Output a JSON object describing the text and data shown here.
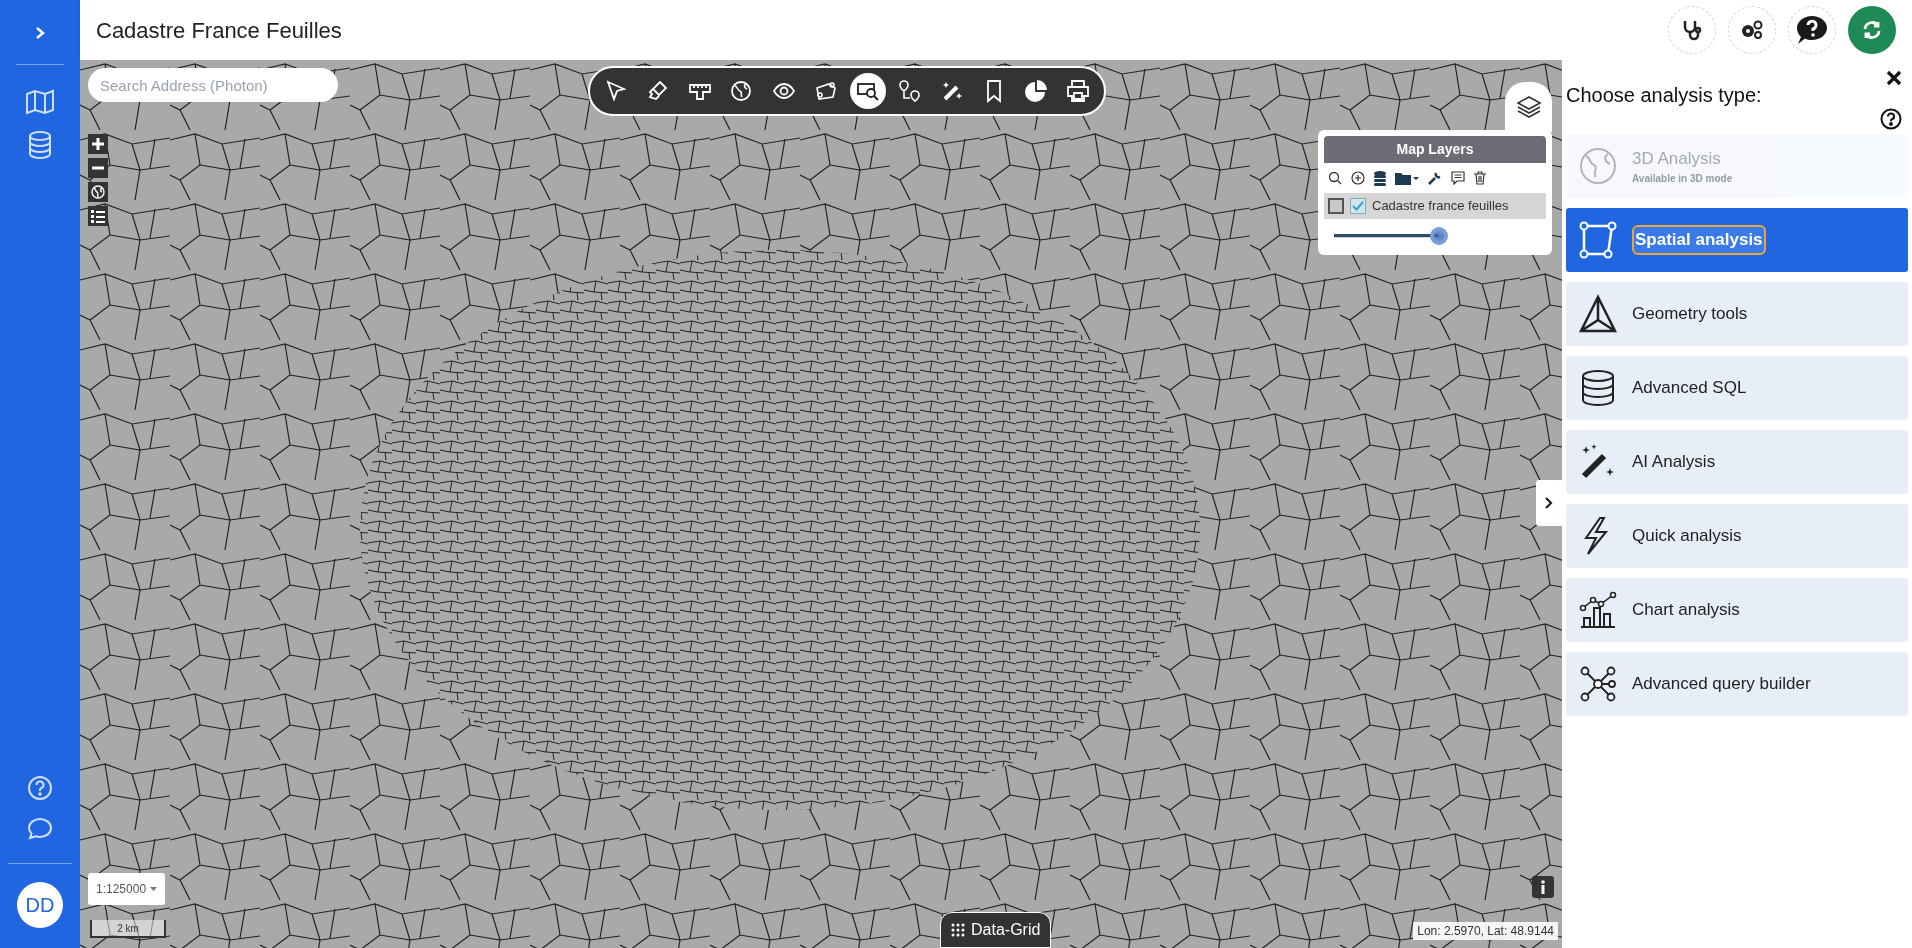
{
  "header": {
    "title": "Cadastre France Feuilles"
  },
  "search": {
    "placeholder": "Search Address (Photon)"
  },
  "toolbar": {
    "tools": [
      {
        "selected": false
      },
      {
        "selected": false
      },
      {
        "selected": false
      },
      {
        "selected": false
      },
      {
        "selected": false
      },
      {
        "selected": false
      },
      {
        "selected": true
      },
      {
        "selected": false
      },
      {
        "selected": false
      },
      {
        "selected": false
      },
      {
        "selected": false
      },
      {
        "selected": false
      }
    ]
  },
  "layers_panel": {
    "title": "Map Layers",
    "layers": [
      {
        "name": "Cadastre france feuilles",
        "selected": false,
        "visible": true,
        "opacity": {
          "level": 0.95
        }
      }
    ]
  },
  "analysis_panel": {
    "title": "Choose analysis type:",
    "items": [
      {
        "label": "3D Analysis",
        "subtitle": "Available in 3D mode",
        "disabled": true,
        "selected": false
      },
      {
        "label": "Spatial analysis",
        "disabled": false,
        "selected": true
      },
      {
        "label": "Geometry tools",
        "disabled": false,
        "selected": false
      },
      {
        "label": "Advanced SQL",
        "disabled": false,
        "selected": false
      },
      {
        "label": "AI Analysis",
        "disabled": false,
        "selected": false
      },
      {
        "label": "Quick analysis",
        "disabled": false,
        "selected": false
      },
      {
        "label": "Chart analysis",
        "disabled": false,
        "selected": false
      },
      {
        "label": "Advanced query builder",
        "disabled": false,
        "selected": false
      }
    ]
  },
  "map_footer": {
    "scale_select": "1:125000",
    "scale_bar": "2 km",
    "data_grid_button": "Data-Grid",
    "coordinates": "Lon: 2.5970, Lat: 48.9144"
  },
  "user": {
    "initials": "DD"
  }
}
